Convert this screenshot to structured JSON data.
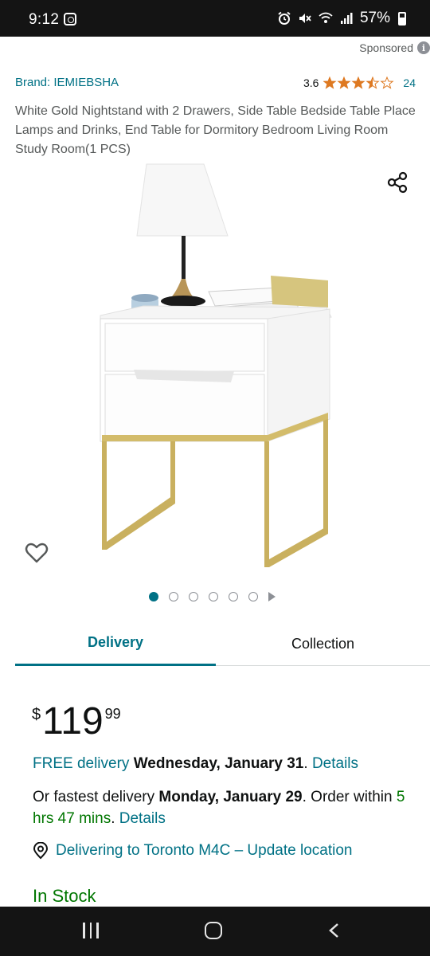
{
  "status": {
    "time": "9:12",
    "battery": "57%"
  },
  "sponsored": "Sponsored",
  "brand": "Brand: IEMIEBSHA",
  "rating": {
    "value": "3.6",
    "stars": 3.5,
    "count": "24"
  },
  "title": "White Gold Nightstand with 2 Drawers, Side Table Bedside Table Place Lamps and Drinks, End Table for Dormitory Bedroom Living Room Study Room(1 PCS)",
  "carousel": {
    "total": 6,
    "active": 0
  },
  "tabs": [
    {
      "label": "Delivery",
      "selected": true
    },
    {
      "label": "Collection",
      "selected": false
    }
  ],
  "price": {
    "symbol": "$",
    "whole": "119",
    "fraction": "99"
  },
  "delivery": {
    "free_label": "FREE delivery",
    "free_date": "Wednesday, January 31",
    "free_suffix": ".",
    "details_1": "Details",
    "fast_prefix": "Or fastest delivery",
    "fast_date": "Monday, January 29",
    "fast_mid": ". Order within",
    "fast_time": "5 hrs 47 mins",
    "fast_suffix": ".",
    "details_2": "Details"
  },
  "location": "Delivering to Toronto M4C – Update location",
  "stock": "In Stock",
  "colors": {
    "link": "#007185",
    "green": "#007600",
    "star": "#de7921"
  }
}
